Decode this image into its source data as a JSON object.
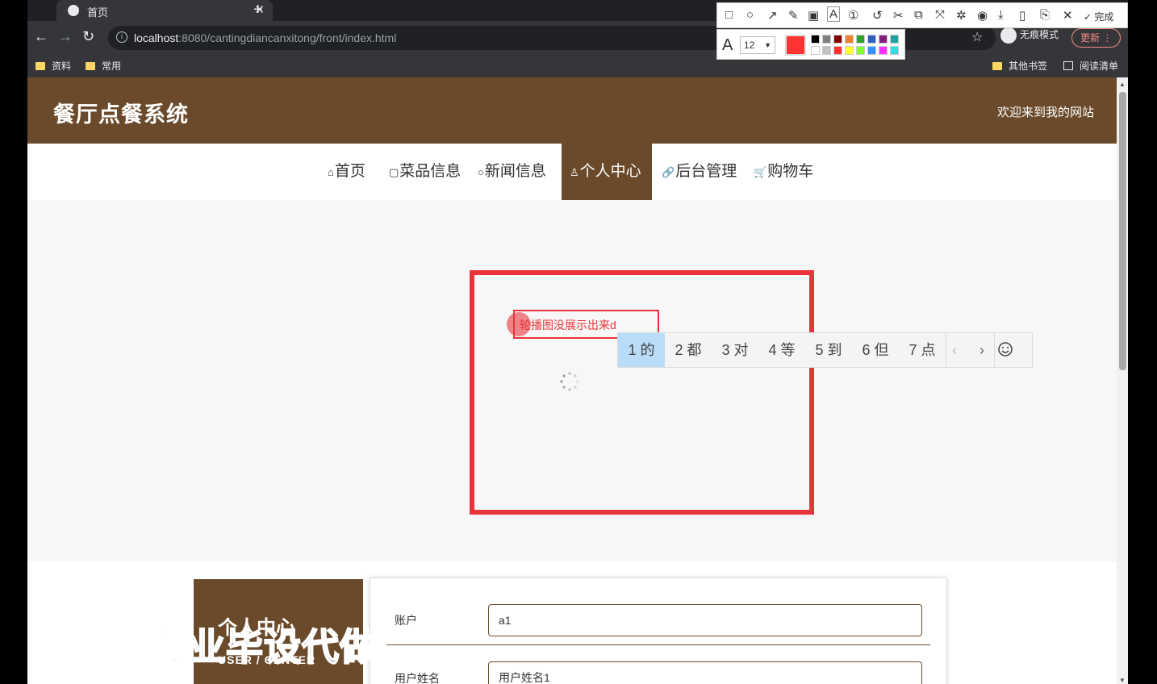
{
  "browser": {
    "tab_title": "首页",
    "url_host": "localhost",
    "url_rest": ":8080/cantingdiancanxitong/front/index.html",
    "incognito_label": "无痕模式",
    "update_label": "更新",
    "bookmarks": [
      "资料",
      "常用"
    ],
    "bookmarks_right": [
      "其他书签",
      "阅读清单"
    ]
  },
  "snip_tool": {
    "done_label": "完成",
    "font_size": "12",
    "current_color": "#ff3333",
    "palette": [
      "#000000",
      "#808080",
      "#800000",
      "#f08030",
      "#30a030",
      "#3060c0",
      "#802080",
      "#20a0a0",
      "#ffffff",
      "#c0c0c0",
      "#ff3333",
      "#ffff30",
      "#80ff30",
      "#3090ff",
      "#ff30ff",
      "#30e0e0"
    ]
  },
  "site": {
    "brand": "餐厅点餐系统",
    "welcome": "欢迎来到我的网站",
    "nav": [
      {
        "icon": "⌂",
        "label": "首页"
      },
      {
        "icon": "▢",
        "label": "菜品信息"
      },
      {
        "icon": "○",
        "label": "新闻信息"
      },
      {
        "icon": "♙",
        "label": "个人中心"
      },
      {
        "icon": "🔗",
        "label": "后台管理"
      },
      {
        "icon": "🛒",
        "label": "购物车"
      }
    ],
    "active_nav": 3
  },
  "annotation": {
    "text": "轮播图没展示出来d",
    "ime_candidates": [
      "1 的",
      "2 都",
      "3 对",
      "4 等",
      "5 到",
      "6 但",
      "7 点"
    ]
  },
  "personal": {
    "title": "个人中心",
    "subtitle": "USER / CENTER",
    "watermark": "专业毕设代做",
    "fields": [
      {
        "label": "账户",
        "value": "a1"
      },
      {
        "label": "用户姓名",
        "value": "用户姓名1"
      }
    ]
  }
}
